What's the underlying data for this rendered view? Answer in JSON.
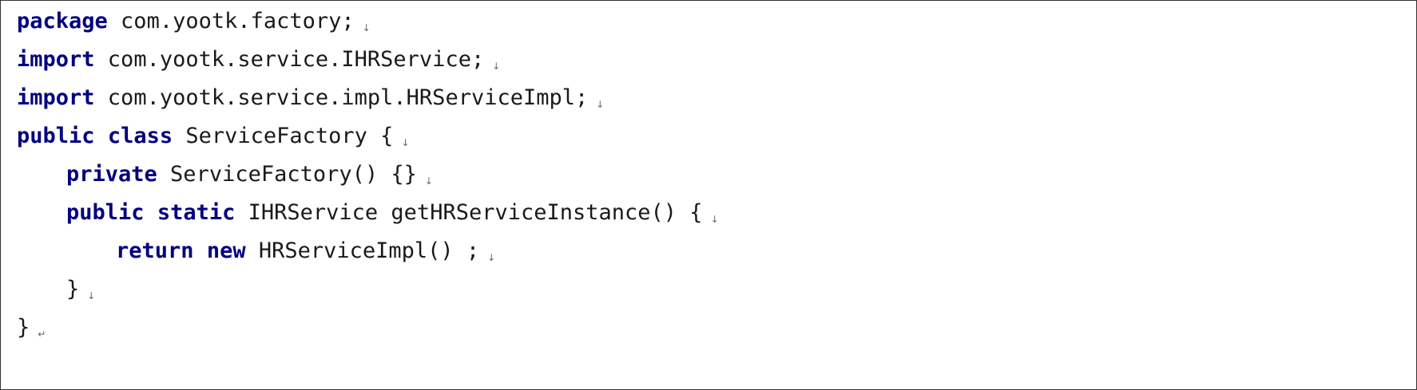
{
  "code": {
    "line1": {
      "kw": "package",
      "text": " com.yootk.factory;",
      "mark": "↓"
    },
    "line2": {
      "kw": "import",
      "text": " com.yootk.service.IHRService;",
      "mark": "↓"
    },
    "line3": {
      "kw": "import",
      "text": " com.yootk.service.impl.HRServiceImpl;",
      "mark": "↓"
    },
    "line4": {
      "kw1": "public",
      "kw2": "class",
      "text": " ServiceFactory {",
      "mark": "↓"
    },
    "line5": {
      "kw": "private",
      "text": " ServiceFactory() {}",
      "mark": "↓"
    },
    "line6": {
      "kw1": "public",
      "kw2": "static",
      "text": " IHRService getHRServiceInstance() {",
      "mark": "↓"
    },
    "line7": {
      "kw1": "return",
      "kw2": "new",
      "text": " HRServiceImpl() ;",
      "mark": "↓"
    },
    "line8": {
      "text": "}",
      "mark": "↓"
    },
    "line9": {
      "text": "}",
      "mark": "↵"
    }
  }
}
